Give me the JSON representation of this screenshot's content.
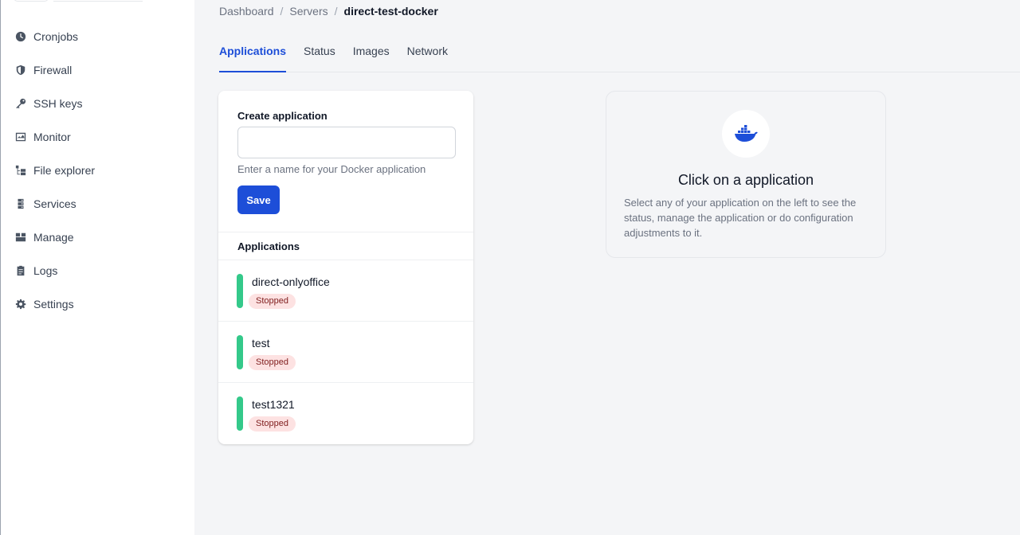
{
  "sidebar": {
    "items": [
      {
        "label": "Cronjobs",
        "icon": "clock-icon"
      },
      {
        "label": "Firewall",
        "icon": "shield-icon"
      },
      {
        "label": "SSH keys",
        "icon": "key-icon"
      },
      {
        "label": "Monitor",
        "icon": "monitor-icon"
      },
      {
        "label": "File explorer",
        "icon": "folder-tree-icon"
      },
      {
        "label": "Services",
        "icon": "server-icon"
      },
      {
        "label": "Manage",
        "icon": "box-icon"
      },
      {
        "label": "Logs",
        "icon": "clipboard-icon"
      },
      {
        "label": "Settings",
        "icon": "gear-icon"
      }
    ]
  },
  "breadcrumb": {
    "items": [
      "Dashboard",
      "Servers"
    ],
    "current": "direct-test-docker"
  },
  "tabs": [
    {
      "label": "Applications",
      "active": true
    },
    {
      "label": "Status",
      "active": false
    },
    {
      "label": "Images",
      "active": false
    },
    {
      "label": "Network",
      "active": false
    }
  ],
  "create": {
    "label": "Create application",
    "input_value": "",
    "input_placeholder": "",
    "help": "Enter a name for your Docker application",
    "save_label": "Save"
  },
  "applications": {
    "header": "Applications",
    "items": [
      {
        "name": "direct-onlyoffice",
        "status": "Stopped"
      },
      {
        "name": "test",
        "status": "Stopped"
      },
      {
        "name": "test1321",
        "status": "Stopped"
      }
    ]
  },
  "empty_state": {
    "icon": "docker-icon",
    "title": "Click on a application",
    "description": "Select any of your application on the left to see the status, manage the application or do configuration adjustments to it."
  },
  "colors": {
    "accent": "#1d4ed8",
    "status_bar": "#34c98a",
    "badge_bg": "#fde2e2"
  }
}
